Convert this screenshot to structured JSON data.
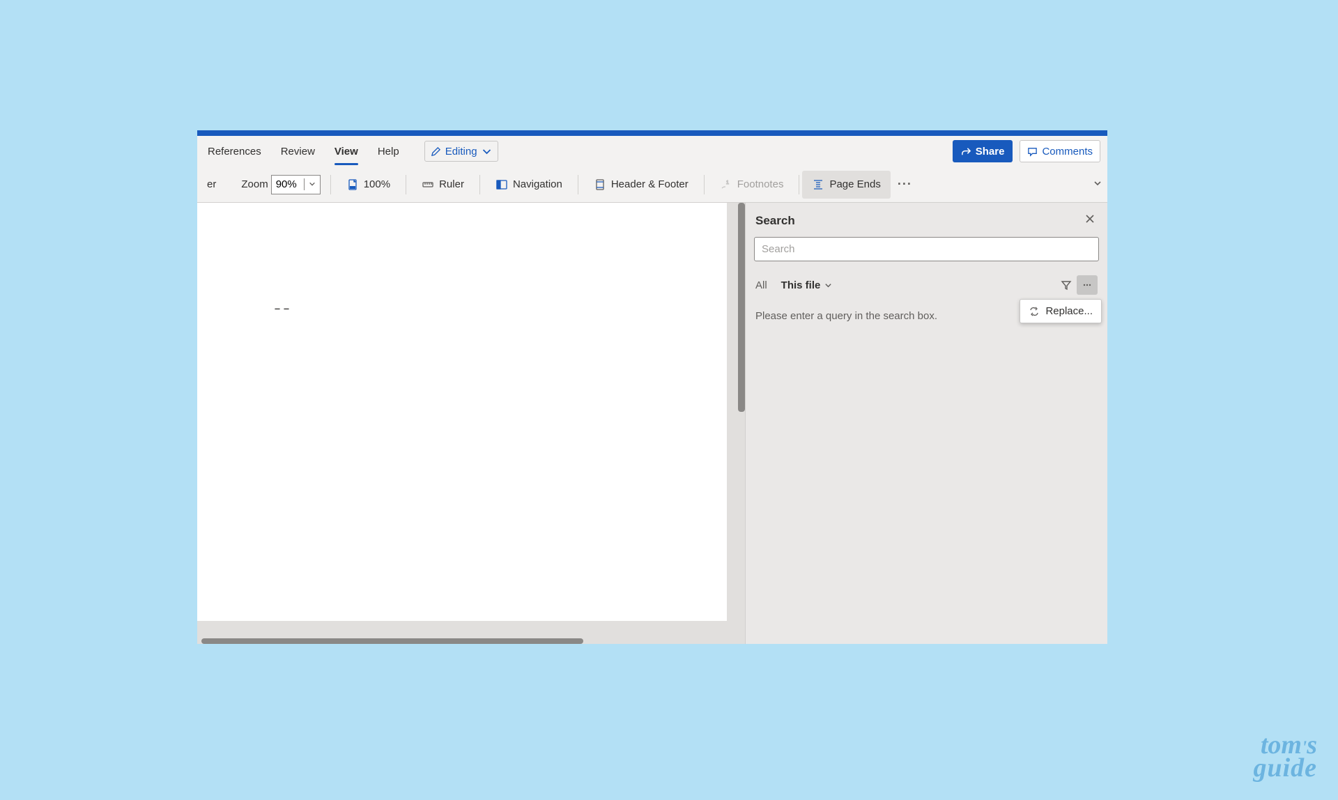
{
  "ribbon": {
    "tabs": [
      "References",
      "Review",
      "View",
      "Help"
    ],
    "active_tab": "View",
    "editing_label": "Editing",
    "share_label": "Share",
    "comments_label": "Comments"
  },
  "toolbar": {
    "er_label": "er",
    "zoom_label": "Zoom",
    "zoom_value": "90%",
    "zoom100_label": "100%",
    "ruler_label": "Ruler",
    "navigation_label": "Navigation",
    "header_footer_label": "Header & Footer",
    "footnotes_label": "Footnotes",
    "page_ends_label": "Page Ends"
  },
  "document": {
    "content": "––"
  },
  "search_panel": {
    "title": "Search",
    "placeholder": "Search",
    "filter_all": "All",
    "filter_this_file": "This file",
    "message": "Please enter a query in the search box.",
    "replace_label": "Replace..."
  },
  "watermark": {
    "line1": "tom's",
    "line2": "guide"
  }
}
